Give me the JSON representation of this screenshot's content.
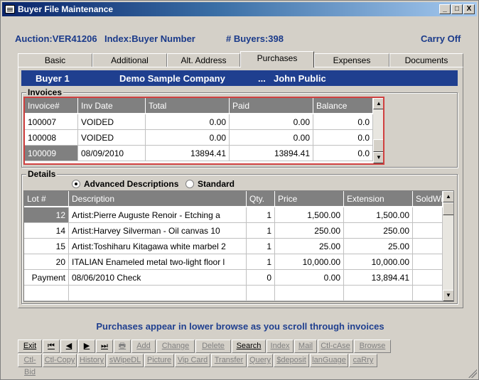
{
  "window": {
    "title": "Buyer File Maintenance",
    "min": "_",
    "max": "□",
    "close": "X"
  },
  "header": {
    "auction": "Auction:VER41206",
    "index": "Index:Buyer Number",
    "buyers": "# Buyers:398",
    "carry": "Carry Off"
  },
  "tabs": [
    "Basic",
    "Additional",
    "Alt. Address",
    "Purchases",
    "Expenses",
    "Documents"
  ],
  "active_tab": "Purchases",
  "buyer_bar": {
    "buyer": "Buyer 1",
    "company": "Demo Sample Company",
    "dots": "...",
    "name": "John Public"
  },
  "invoices": {
    "label": "Invoices",
    "columns": [
      "Invoice#",
      "Inv Date",
      "Total",
      "Paid",
      "Balance"
    ],
    "rows": [
      [
        "100007",
        "VOIDED",
        "0.00",
        "0.00",
        "0.0"
      ],
      [
        "100008",
        "VOIDED",
        "0.00",
        "0.00",
        "0.0"
      ],
      [
        "100009",
        "08/09/2010",
        "13894.41",
        "13894.41",
        "0.0"
      ]
    ]
  },
  "details": {
    "label": "Details",
    "radio_advanced": "Advanced Descriptions",
    "radio_standard": "Standard",
    "columns": [
      "Lot #",
      "Description",
      "Qty.",
      "Price",
      "Extension",
      "SoldWi"
    ],
    "rows": [
      [
        "12",
        "Artist:Pierre Auguste Renoir - Etching a",
        "1",
        "1,500.00",
        "1,500.00",
        ""
      ],
      [
        "14",
        "Artist:Harvey Silverman - Oil canvas 10",
        "1",
        "250.00",
        "250.00",
        ""
      ],
      [
        "15",
        "Artist:Toshiharu Kitagawa white marbel 2",
        "1",
        "25.00",
        "25.00",
        ""
      ],
      [
        "20",
        "ITALIAN Enameled metal two-light floor l",
        "1",
        "10,000.00",
        "10,000.00",
        ""
      ],
      [
        "Payment",
        "08/06/2010 Check",
        "0",
        "0.00",
        "13,894.41",
        ""
      ],
      [
        "",
        "",
        "",
        "",
        "",
        ""
      ]
    ]
  },
  "message": "Purchases appear in lower browse as you scroll through invoices",
  "buttons_row1": [
    {
      "l": "Exit",
      "en": true
    },
    {
      "l": "⏮",
      "en": true
    },
    {
      "l": "◀",
      "en": true
    },
    {
      "l": "▶",
      "en": true
    },
    {
      "l": "⏭",
      "en": true
    },
    {
      "l": "🖶",
      "en": false
    },
    {
      "l": "Add",
      "en": false
    },
    {
      "l": "Change",
      "en": false
    },
    {
      "l": "Delete",
      "en": false
    },
    {
      "l": "Search",
      "en": true
    },
    {
      "l": "Index",
      "en": false
    },
    {
      "l": "Mail",
      "en": false
    },
    {
      "l": "Ctl-cAse",
      "en": false
    },
    {
      "l": "Browse",
      "en": false
    }
  ],
  "buttons_row2": [
    {
      "l": "Ctl-Bid",
      "en": false
    },
    {
      "l": "Ctl-Copy",
      "en": false
    },
    {
      "l": "History",
      "en": false
    },
    {
      "l": "sWipeDL",
      "en": false
    },
    {
      "l": "Picture",
      "en": false
    },
    {
      "l": "Vip Card",
      "en": false
    },
    {
      "l": "Transfer",
      "en": false
    },
    {
      "l": "Query",
      "en": false
    },
    {
      "l": "$deposit",
      "en": false
    },
    {
      "l": "lanGuage",
      "en": false
    },
    {
      "l": "caRry",
      "en": false
    }
  ]
}
